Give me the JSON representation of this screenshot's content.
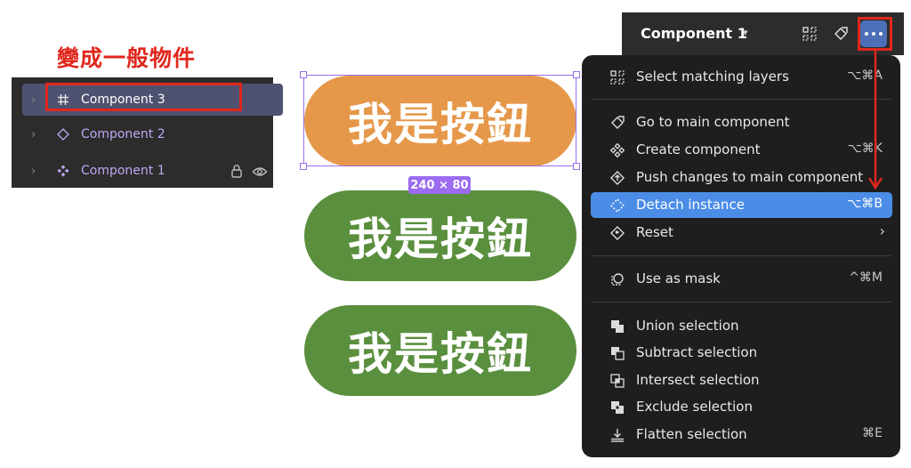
{
  "annotation": {
    "text": "變成一般物件",
    "color": "#e0271c"
  },
  "layers": {
    "items": [
      {
        "label": "Component 3",
        "icon": "frame-hash-icon",
        "selected": true
      },
      {
        "label": "Component 2",
        "icon": "instance-diamond-icon",
        "selected": false
      },
      {
        "label": "Component 1",
        "icon": "component-icon",
        "selected": false
      }
    ]
  },
  "canvas": {
    "buttons": [
      {
        "text": "我是按鈕",
        "color": "#e6984a"
      },
      {
        "text": "我是按鈕",
        "color": "#5a8f3e"
      },
      {
        "text": "我是按鈕",
        "color": "#5a8f3e"
      }
    ],
    "size_badge": "240 × 80"
  },
  "topbar": {
    "title": "Component 1",
    "icons": [
      "select-matching-icon",
      "go-to-main-icon",
      "more-options-icon"
    ]
  },
  "menu": {
    "items": [
      {
        "label": "Select matching layers",
        "shortcut": "⌥⌘A",
        "icon": "select-matching-icon"
      },
      {
        "label": "Go to main component",
        "shortcut": "",
        "icon": "go-to-main-icon"
      },
      {
        "label": "Create component",
        "shortcut": "⌥⌘K",
        "icon": "create-component-icon"
      },
      {
        "label": "Push changes to main component",
        "shortcut": "",
        "icon": "push-changes-icon"
      },
      {
        "label": "Detach instance",
        "shortcut": "⌥⌘B",
        "icon": "detach-icon",
        "active": true
      },
      {
        "label": "Reset",
        "shortcut": "",
        "icon": "reset-icon",
        "submenu": true
      },
      {
        "label": "Use as mask",
        "shortcut": "^⌘M",
        "icon": "mask-icon"
      },
      {
        "label": "Union selection",
        "shortcut": "",
        "icon": "union-icon"
      },
      {
        "label": "Subtract selection",
        "shortcut": "",
        "icon": "subtract-icon"
      },
      {
        "label": "Intersect selection",
        "shortcut": "",
        "icon": "intersect-icon"
      },
      {
        "label": "Exclude selection",
        "shortcut": "",
        "icon": "exclude-icon"
      },
      {
        "label": "Flatten selection",
        "shortcut": "⌘E",
        "icon": "flatten-icon"
      }
    ],
    "submenu_glyph": "›"
  },
  "colors": {
    "accent": "#4b8de6",
    "selection": "#9b6cf0",
    "annotation": "#e0271c"
  }
}
